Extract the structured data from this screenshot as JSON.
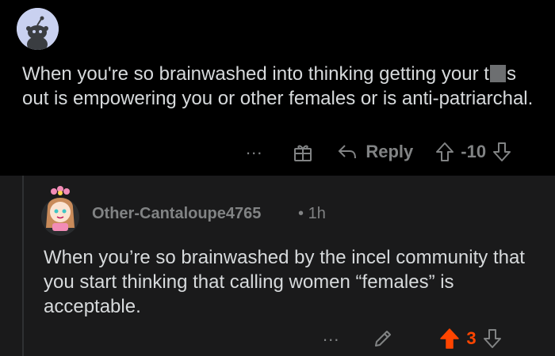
{
  "top_comment": {
    "avatar_icon": "snoo-avatar-icon",
    "text_before_redaction": "When you're so brainwashed into thinking getting your t",
    "text_after_redaction": "s out is empowering you or other females or is anti-patriarchal.",
    "actions": {
      "more_label": "...",
      "award_icon": "gift-icon",
      "reply_label": "Reply",
      "score": "-10"
    }
  },
  "reply_comment": {
    "avatar_icon": "character-avatar-icon",
    "username": "Other-Cantaloupe4765",
    "separator": "•",
    "time": "1h",
    "text": "When you’re so brainwashed by the incel community that you start thinking that calling women “females” is acceptable.",
    "actions": {
      "more_label": "...",
      "edit_icon": "pencil-icon",
      "score": "3"
    }
  },
  "colors": {
    "upvote_active": "#ff4500",
    "muted": "#818384",
    "text": "#d7dadc",
    "reply_bg": "#1a1a1b"
  }
}
